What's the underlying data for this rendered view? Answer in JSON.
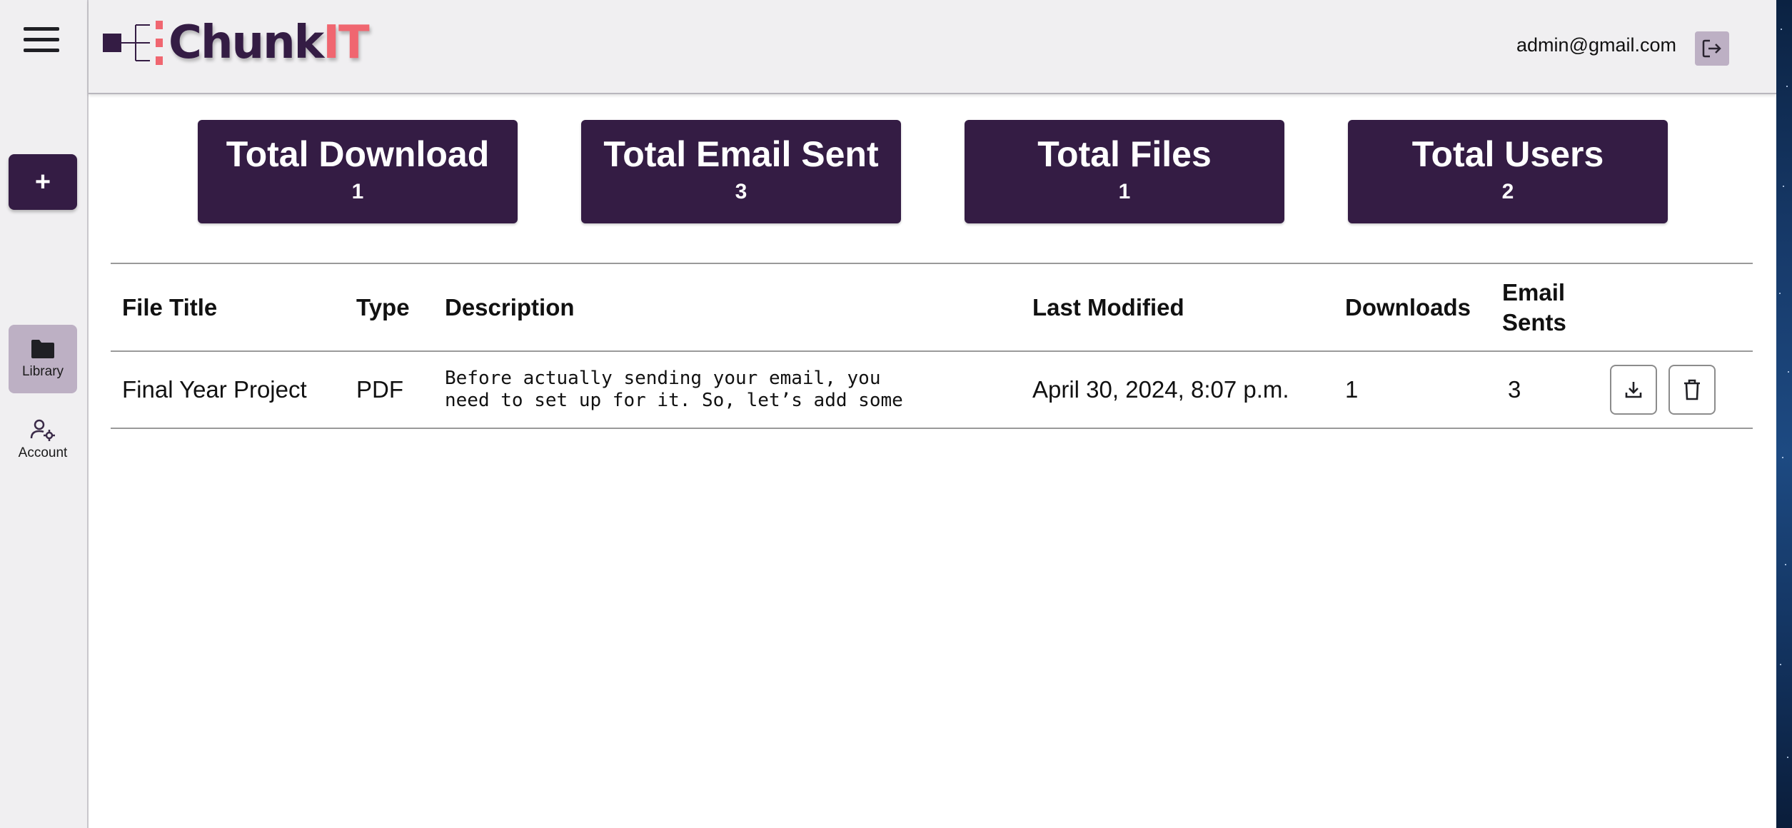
{
  "app": {
    "logo_main": "Chunk",
    "logo_accent": "IT",
    "brand_color": "#341c44",
    "accent_color": "#f06670"
  },
  "header": {
    "user_email": "admin@gmail.com",
    "logout_icon": "logout-icon"
  },
  "sidebar": {
    "menu_icon": "hamburger-menu-icon",
    "add_label": "+",
    "items": [
      {
        "label": "Library",
        "icon": "folder-icon",
        "active": true
      },
      {
        "label": "Account",
        "icon": "user-settings-icon",
        "active": false
      }
    ]
  },
  "stats": [
    {
      "title": "Total Download",
      "value": "1"
    },
    {
      "title": "Total Email Sent",
      "value": "3"
    },
    {
      "title": "Total Files",
      "value": "1"
    },
    {
      "title": "Total Users",
      "value": "2"
    }
  ],
  "table": {
    "columns": [
      "File Title",
      "Type",
      "Description",
      "Last Modified",
      "Downloads",
      "Email Sents"
    ],
    "rows": [
      {
        "title": "Final Year Project",
        "type": "PDF",
        "description_line1": "Before actually sending your email, you",
        "description_line2": "need to set up for it. So, let’s add some",
        "last_modified": "April 30, 2024, 8:07 p.m.",
        "downloads": "1",
        "email_sents": "3"
      }
    ],
    "row_actions": [
      "download-icon",
      "trash-icon"
    ]
  }
}
